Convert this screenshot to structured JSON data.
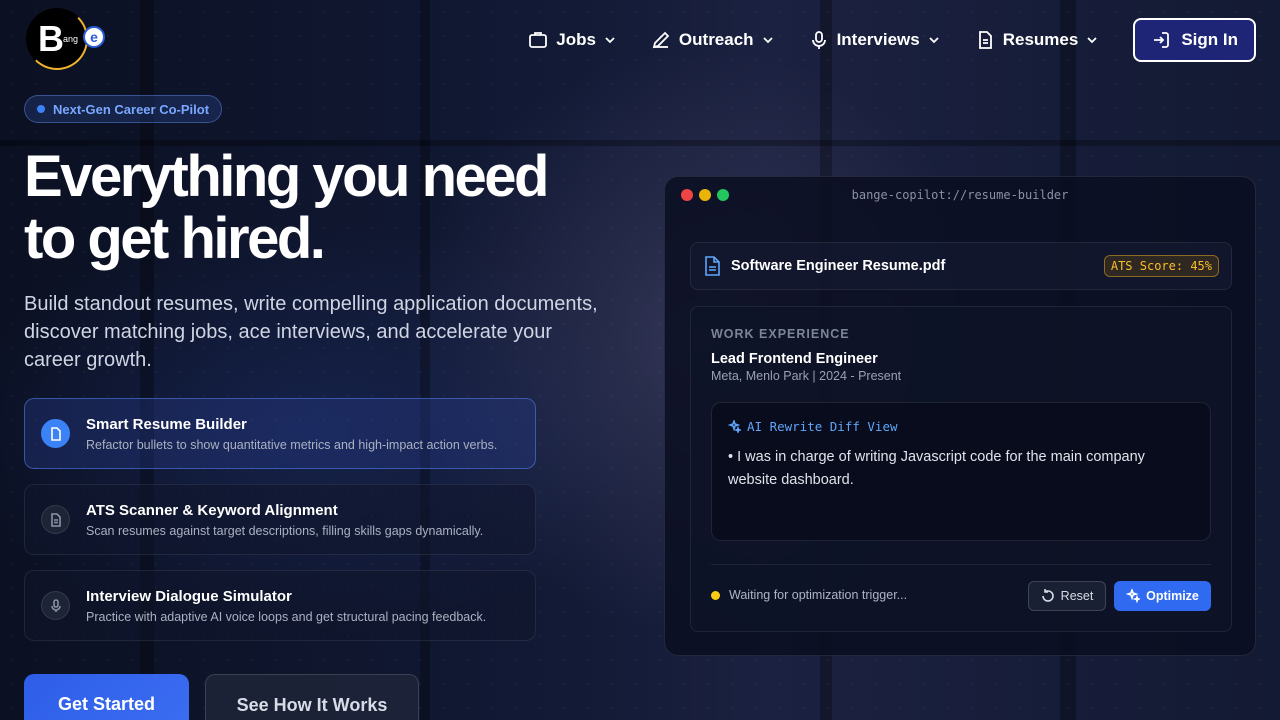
{
  "brand": {
    "logo_letter": "B",
    "logo_middle": "ang",
    "logo_end": "e"
  },
  "nav": {
    "items": [
      {
        "label": "Jobs",
        "icon": "briefcase-icon"
      },
      {
        "label": "Outreach",
        "icon": "pen-icon"
      },
      {
        "label": "Interviews",
        "icon": "mic-icon"
      },
      {
        "label": "Resumes",
        "icon": "document-icon"
      }
    ],
    "signin_label": "Sign In"
  },
  "hero": {
    "badge": "Next-Gen Career Co-Pilot",
    "headline_line1": "Everything you need",
    "headline_line2": "to get hired.",
    "subtext": "Build standout resumes, write compelling application documents, discover matching jobs, ace interviews, and accelerate your career growth."
  },
  "features": [
    {
      "title": "Smart Resume Builder",
      "desc": "Refactor bullets to show quantitative metrics and high-impact action verbs.",
      "icon": "document-icon"
    },
    {
      "title": "ATS Scanner & Keyword Alignment",
      "desc": "Scan resumes against target descriptions, filling skills gaps dynamically.",
      "icon": "file-text-icon"
    },
    {
      "title": "Interview Dialogue Simulator",
      "desc": "Practice with adaptive AI voice loops and get structural pacing feedback.",
      "icon": "mic-icon"
    }
  ],
  "cta": {
    "primary": "Get Started",
    "secondary": "See How It Works"
  },
  "preview": {
    "url": "bange-copilot://resume-builder",
    "file_name": "Software Engineer Resume.pdf",
    "ats_score": "ATS Score: 45%",
    "section_label": "WORK EXPERIENCE",
    "role": "Lead Frontend Engineer",
    "company": "Meta, Menlo Park | 2024 - Present",
    "diff_title": "AI Rewrite Diff View",
    "diff_text": "• I was in charge of writing Javascript code for the main company website dashboard.",
    "status": "Waiting for optimization trigger...",
    "reset_label": "Reset",
    "optimize_label": "Optimize"
  },
  "colors": {
    "accent": "#3b82f6",
    "warning": "#fbbf24",
    "traffic_red": "#ef4444",
    "traffic_yellow": "#eab308",
    "traffic_green": "#22c55e"
  }
}
